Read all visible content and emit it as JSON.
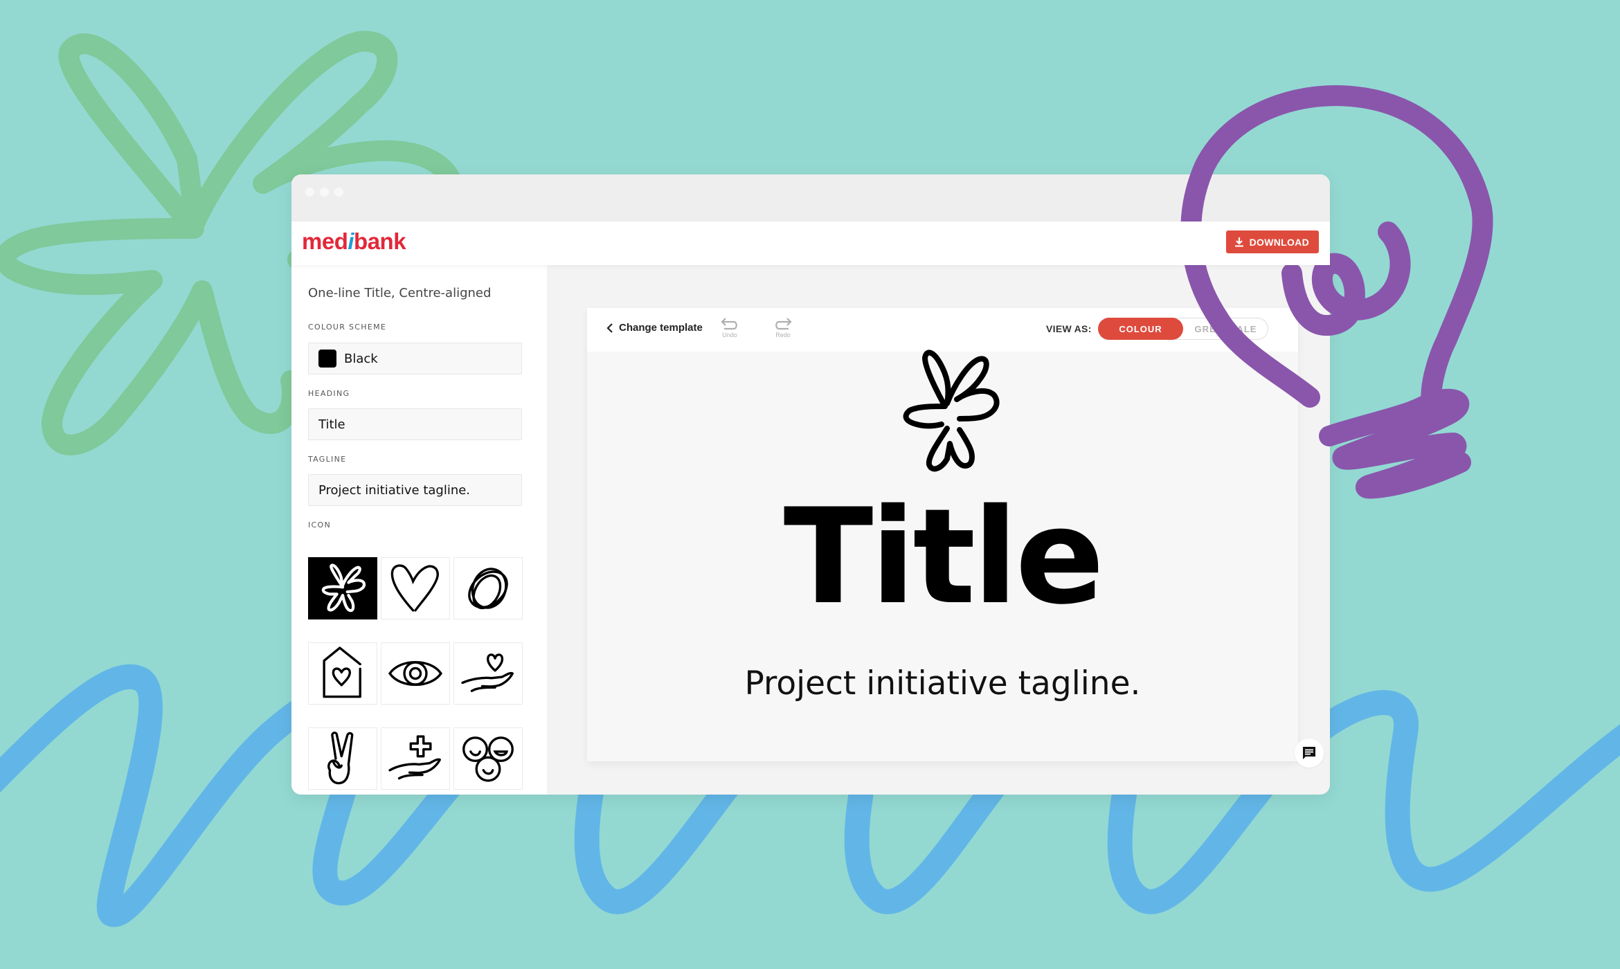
{
  "colors": {
    "background": "#93D9D2",
    "decor_green": "#7FC99A",
    "decor_purple": "#8A56AC",
    "decor_blue": "#62B6E7",
    "brand_red": "#E2283A",
    "brand_blue": "#1F9CD8",
    "accent_button": "#DE4B3D"
  },
  "header": {
    "logo_prefix": "med",
    "logo_i": "i",
    "logo_suffix": "bank",
    "download_label": "DOWNLOAD",
    "download_icon": "download-icon"
  },
  "sidebar": {
    "template_name": "One-line Title, Centre-aligned",
    "colour_scheme": {
      "label": "COLOUR SCHEME",
      "value": "Black",
      "swatch": "#000000"
    },
    "heading": {
      "label": "HEADING",
      "value": "Title"
    },
    "tagline": {
      "label": "TAGLINE",
      "value": "Project initiative tagline."
    },
    "icon": {
      "label": "ICON",
      "options": [
        {
          "name": "flower-icon",
          "selected": true
        },
        {
          "name": "heart-icon",
          "selected": false
        },
        {
          "name": "scribble-circle-icon",
          "selected": false
        },
        {
          "name": "house-heart-icon",
          "selected": false
        },
        {
          "name": "eye-icon",
          "selected": false
        },
        {
          "name": "hand-heart-icon",
          "selected": false
        },
        {
          "name": "peace-hand-icon",
          "selected": false
        },
        {
          "name": "hand-cross-icon",
          "selected": false
        },
        {
          "name": "smiling-faces-icon",
          "selected": false
        }
      ]
    }
  },
  "toolbar": {
    "change_template_label": "Change template",
    "undo_label": "Undo",
    "redo_label": "Redo",
    "view_as_label": "VIEW AS:",
    "view_options": [
      {
        "label": "COLOUR",
        "active": true
      },
      {
        "label": "GREYSCALE",
        "active": false
      }
    ]
  },
  "preview": {
    "icon": "flower-icon",
    "title": "Title",
    "tagline": "Project initiative tagline."
  },
  "chat": {
    "icon": "chat-icon"
  }
}
